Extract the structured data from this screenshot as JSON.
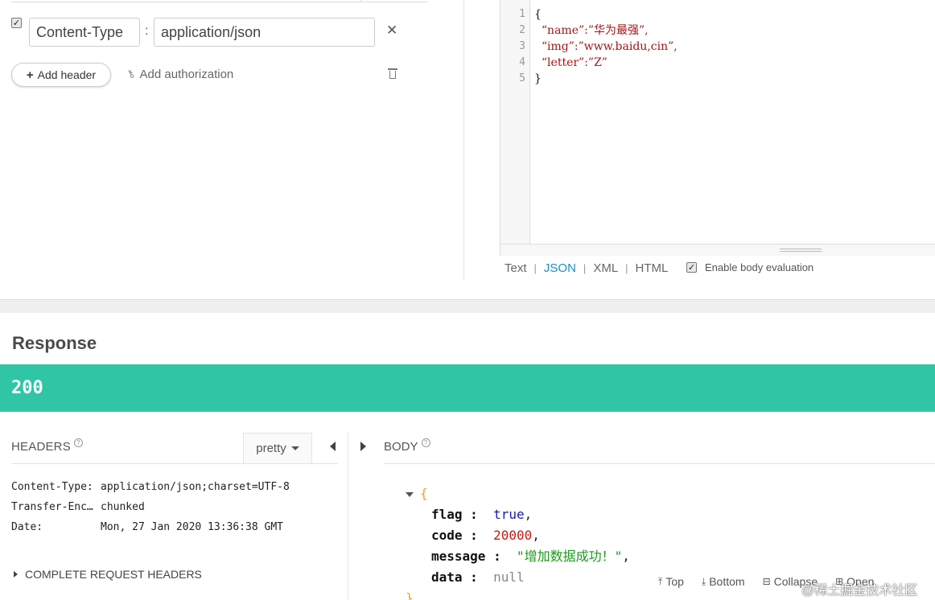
{
  "request": {
    "header_row": {
      "enabled": true,
      "name": "Content-Type",
      "separator": ":",
      "value": "application/json",
      "remove_icon": "close-icon"
    },
    "add_header_label": "Add header",
    "add_authorization_label": "Add authorization",
    "icons": {
      "plus": "plus-icon",
      "key": "key-icon",
      "trash": "trash-icon"
    }
  },
  "editor": {
    "line_numbers": [
      "1",
      "2",
      "3",
      "4",
      "5"
    ],
    "lines": [
      "{",
      "  “name”:”华为最强”,",
      "  “img”:”www.baidu,cin”,",
      "  “letter”:”Z”",
      "}"
    ],
    "format_tabs": [
      "Text",
      "JSON",
      "XML",
      "HTML"
    ],
    "active_format": "JSON",
    "enable_body_evaluation": {
      "checked": true,
      "label": "Enable body evaluation"
    }
  },
  "response": {
    "title": "Response",
    "status_code": "200",
    "status_color": "#2fc5a5",
    "headers_panel": {
      "label": "HEADERS",
      "format_select": "pretty",
      "rows": [
        {
          "key": "Content-Type:",
          "value": "application/json;charset=UTF-8"
        },
        {
          "key": "Transfer-Enc…",
          "value": "chunked"
        },
        {
          "key": "Date:",
          "value": "Mon, 27 Jan 2020 13:36:38 GMT"
        }
      ],
      "complete_request_headers": "COMPLETE REQUEST HEADERS"
    },
    "body_panel": {
      "label": "BODY",
      "open_brace": "{",
      "close_brace": "}",
      "fields": [
        {
          "key": "flag",
          "value": "true",
          "type": "bool"
        },
        {
          "key": "code",
          "value": "20000",
          "type": "num"
        },
        {
          "key": "message",
          "value": "\"增加数据成功！\"",
          "type": "str"
        },
        {
          "key": "data",
          "value": "null",
          "type": "null"
        }
      ],
      "toolbar": [
        "Top",
        "Bottom",
        "Collapse",
        "Open"
      ]
    }
  },
  "watermark": "@稀土掘金技术社区"
}
